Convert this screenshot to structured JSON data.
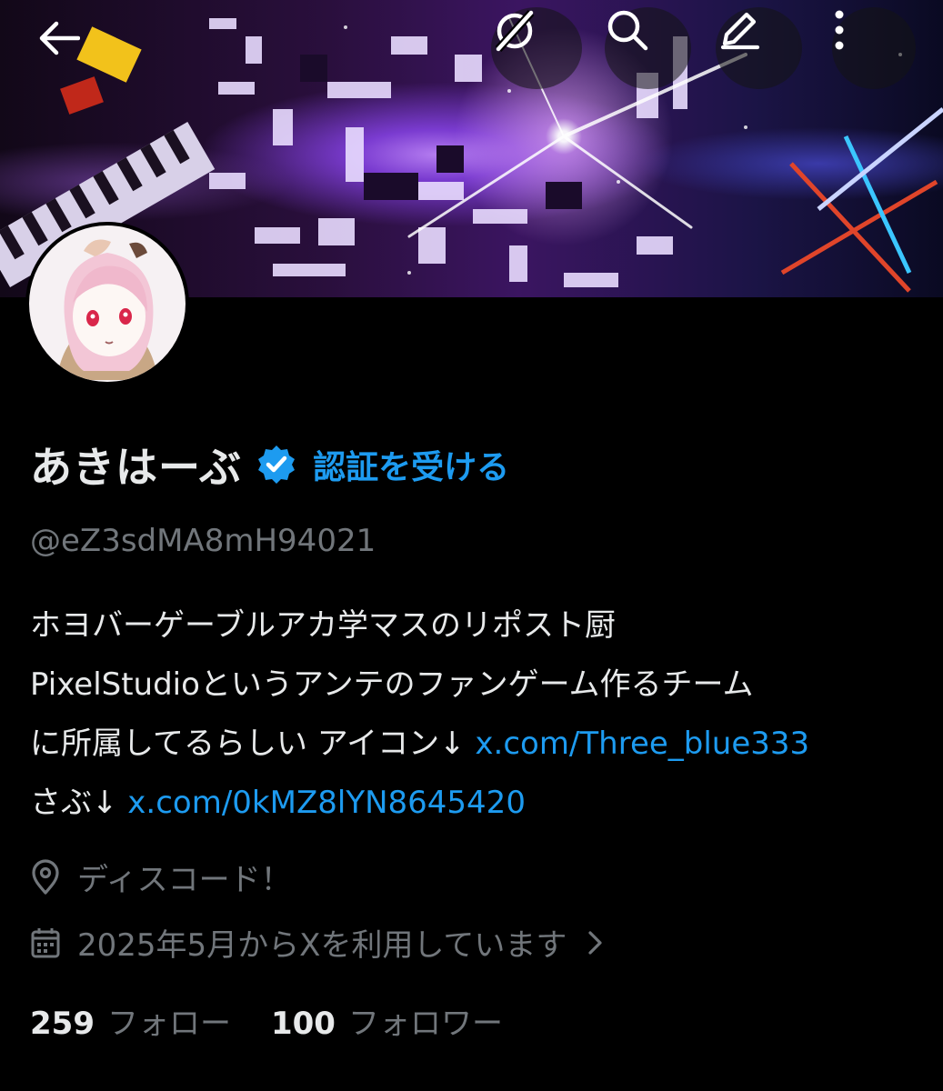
{
  "header": {
    "back_icon": "arrow-left-icon",
    "grok_icon": "grok-icon",
    "search_icon": "search-icon",
    "edit_icon": "edit-icon",
    "more_icon": "more-vertical-icon"
  },
  "profile": {
    "display_name": "あきはーぶ",
    "verified_badge_icon": "verified-badge-icon",
    "get_verified_label": "認証を受ける",
    "handle": "@eZ3sdMA8mH94021",
    "bio": {
      "line1": "ホヨバーゲーブルアカ学マスのリポスト厨",
      "line2": "PixelStudioというアンテのファンゲーム作るチーム",
      "line3_text": "に所属してるらしい アイコン↓ ",
      "line3_link": "x.com/Three_blue333",
      "line4_text": "さぶ↓ ",
      "line4_link": "x.com/0kMZ8lYN8645420"
    },
    "location": "ディスコード！",
    "joined": "2025年5月からXを利用しています",
    "following_count": "259",
    "following_label": "フォロー",
    "followers_count": "100",
    "followers_label": "フォロワー"
  },
  "colors": {
    "background": "#000000",
    "text_primary": "#e7e9ea",
    "text_secondary": "#71767b",
    "accent": "#1d9bf0"
  }
}
